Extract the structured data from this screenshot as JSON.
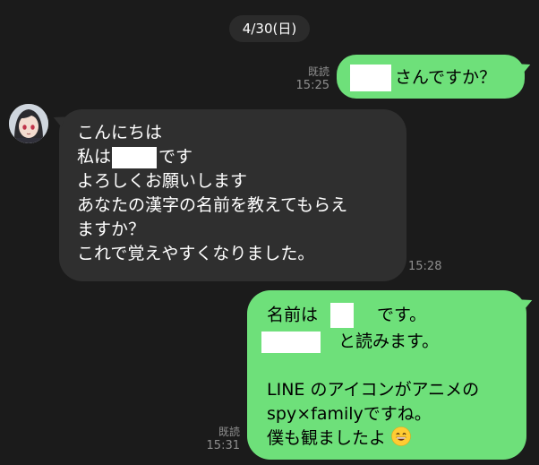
{
  "chat": {
    "date_label": "4/30(日)",
    "colors": {
      "background": "#1b1b1b",
      "outgoing_bubble": "#6ee07a",
      "incoming_bubble": "#2f2f2f",
      "meta_text": "#8f8f8f"
    },
    "messages": [
      {
        "direction": "outgoing",
        "read_label": "既読",
        "time": "15:25",
        "text_after_redaction": "さんですか？"
      },
      {
        "direction": "incoming",
        "time": "15:28",
        "lines": [
          "こんにちは",
          "私は",
          "です",
          "よろしくお願いします",
          "あなたの漢字の名前を教えてもらえ",
          "ますか？",
          "これで覚えやすくなりました。"
        ]
      },
      {
        "direction": "outgoing",
        "read_label": "既読",
        "time": "15:31",
        "lines": [
          "名前は",
          "です。",
          "と読みます。",
          "LINE のアイコンがアニメの",
          "spy×familyですね。",
          "僕も観ましたよ"
        ],
        "emoji": "grinning-face"
      }
    ]
  }
}
